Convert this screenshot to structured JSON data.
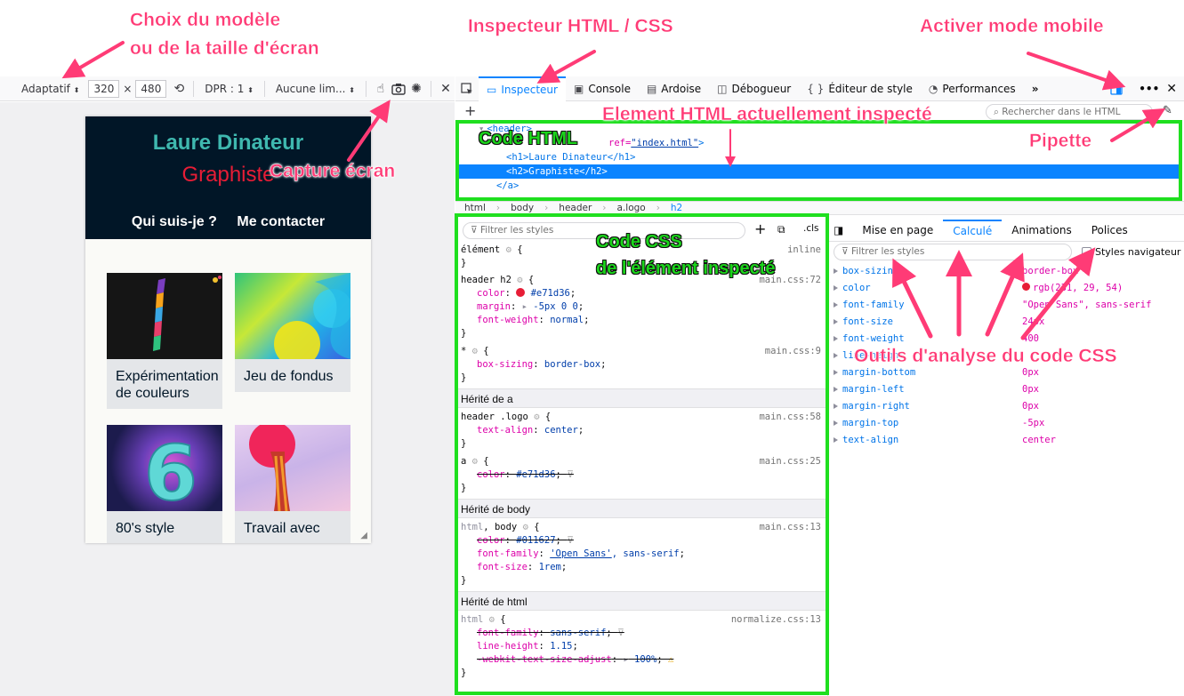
{
  "annotations": {
    "model": "Choix du modèle",
    "model2": "ou de la taille d'écran",
    "inspector": "Inspecteur HTML / CSS",
    "mobile": "Activer mode mobile",
    "element": "Element HTML actuellement inspecté",
    "pipette": "Pipette",
    "capture": "Capture écran",
    "code_html": "Code HTML",
    "code_css": "Code CSS",
    "code_css2": "de l'élément inspecté",
    "tools": "Outils d'analyse du code CSS"
  },
  "rdm": {
    "preset": "Adaptatif",
    "width": "320",
    "times": "×",
    "height": "480",
    "dpr": "DPR : 1",
    "throttle": "Aucune lim..."
  },
  "devtools": {
    "tabs": [
      {
        "label": "Inspecteur"
      },
      {
        "label": "Console"
      },
      {
        "label": "Ardoise"
      },
      {
        "label": "Débogueur"
      },
      {
        "label": "Éditeur de style"
      },
      {
        "label": "Performances"
      }
    ],
    "more": "»",
    "search_placeholder": "Rechercher dans le HTML"
  },
  "site": {
    "h1a": "Laure",
    "h1b": "Dinateur",
    "h2": "Graphiste",
    "nav": [
      "Qui suis-je ?",
      "Me contacter"
    ],
    "cards": [
      "Expérimentation de couleurs",
      "Jeu de fondus",
      "80's style",
      "Travail avec"
    ]
  },
  "markup": {
    "l1": "<header>",
    "l2_attr": "ref=",
    "l2_val": "\"index.html\"",
    "l2_end": ">",
    "l3": "<h1>Laure Dinateur</h1>",
    "l4": "<h2>Graphiste</h2>",
    "l5": "</a>"
  },
  "breadcrumbs": [
    "html",
    "body",
    "header",
    "a.logo",
    "h2"
  ],
  "rules": {
    "filter_placeholder": "Filtrer les styles",
    "cls": ".cls",
    "r1_sel": "élément",
    "r1_src": "inline",
    "r2_sel": "header h2",
    "r2_src": "main.css:72",
    "r2_p1": "color",
    "r2_v1": "#e71d36",
    "r2_p2": "margin",
    "r2_v2": "-5px 0 0",
    "r2_p3": "font-weight",
    "r2_v3": "normal",
    "r3_sel": "*",
    "r3_src": "main.css:9",
    "r3_p1": "box-sizing",
    "r3_v1": "border-box",
    "inh_a": "Hérité de a",
    "r4_sel": "header .logo",
    "r4_src": "main.css:58",
    "r4_p1": "text-align",
    "r4_v1": "center",
    "r5_sel": "a",
    "r5_src": "main.css:25",
    "r5_p1": "color",
    "r5_v1": "#e71d36",
    "inh_body": "Hérité de body",
    "r6_sel_a": "html",
    "r6_sel_b": ", body",
    "r6_src": "main.css:13",
    "r6_p1": "color",
    "r6_v1": "#011627",
    "r6_p2": "font-family",
    "r6_v2a": "'Open Sans'",
    "r6_v2b": ", sans-serif",
    "r6_p3": "font-size",
    "r6_v3": "1rem",
    "inh_html": "Hérité de html",
    "r7_sel": "html",
    "r7_src": "normalize.css:13",
    "r7_p1": "font-family",
    "r7_v1": "sans-serif",
    "r7_p2": "line-height",
    "r7_v2": "1.15",
    "r7_p3": "-webkit-text-size-adjust",
    "r7_v3": "100%"
  },
  "computed": {
    "tabs": [
      "Mise en page",
      "Calculé",
      "Animations",
      "Polices"
    ],
    "filter_placeholder": "Filtrer les styles",
    "browser_styles": "Styles navigateur",
    "props": [
      {
        "p": "box-sizing",
        "v": "border-box"
      },
      {
        "p": "color",
        "v": "rgb(231, 29, 54)"
      },
      {
        "p": "font-family",
        "v": "\"Open Sans\", sans-serif"
      },
      {
        "p": "font-size",
        "v": "24px"
      },
      {
        "p": "font-weight",
        "v": "400"
      },
      {
        "p": "line-height",
        "v": ""
      },
      {
        "p": "margin-bottom",
        "v": "0px"
      },
      {
        "p": "margin-left",
        "v": "0px"
      },
      {
        "p": "margin-right",
        "v": "0px"
      },
      {
        "p": "margin-top",
        "v": "-5px"
      },
      {
        "p": "text-align",
        "v": "center"
      }
    ]
  },
  "colors": {
    "annotation": "#ff3b76",
    "box": "#1fdf1f",
    "accent": "#0a84ff",
    "site_bg": "#011627",
    "site_red": "#e71d36"
  }
}
